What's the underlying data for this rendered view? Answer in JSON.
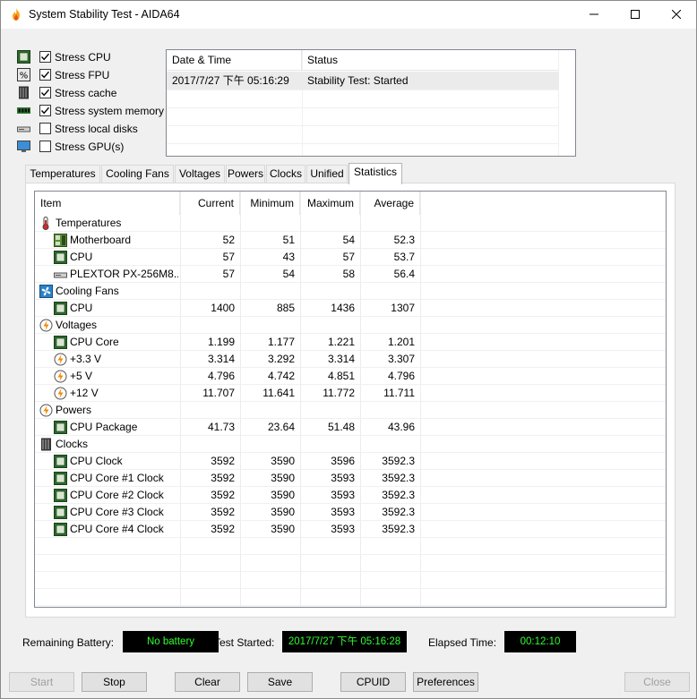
{
  "window": {
    "title": "System Stability Test - AIDA64"
  },
  "stress_options": [
    {
      "label": "Stress CPU",
      "checked": true,
      "icon": "cpu-chip-icon"
    },
    {
      "label": "Stress FPU",
      "checked": true,
      "icon": "fpu-icon"
    },
    {
      "label": "Stress cache",
      "checked": true,
      "icon": "cache-icon"
    },
    {
      "label": "Stress system memory",
      "checked": true,
      "icon": "memory-icon"
    },
    {
      "label": "Stress local disks",
      "checked": false,
      "icon": "disk-icon"
    },
    {
      "label": "Stress GPU(s)",
      "checked": false,
      "icon": "monitor-icon"
    }
  ],
  "log": {
    "headers": {
      "datetime": "Date & Time",
      "status": "Status"
    },
    "rows": [
      {
        "datetime": "2017/7/27 下午 05:16:29",
        "status": "Stability Test: Started"
      }
    ]
  },
  "tabs": [
    "Temperatures",
    "Cooling Fans",
    "Voltages",
    "Powers",
    "Clocks",
    "Unified",
    "Statistics"
  ],
  "active_tab": "Statistics",
  "stats": {
    "headers": {
      "item": "Item",
      "current": "Current",
      "minimum": "Minimum",
      "maximum": "Maximum",
      "average": "Average"
    },
    "rows": [
      {
        "type": "group",
        "label": "Temperatures",
        "icon": "thermometer-icon"
      },
      {
        "type": "item",
        "label": "Motherboard",
        "icon": "motherboard-icon",
        "current": "52",
        "minimum": "51",
        "maximum": "54",
        "average": "52.3"
      },
      {
        "type": "item",
        "label": "CPU",
        "icon": "cpu-chip-icon",
        "current": "57",
        "minimum": "43",
        "maximum": "57",
        "average": "53.7"
      },
      {
        "type": "item",
        "label": "PLEXTOR PX-256M8...",
        "icon": "disk-icon",
        "current": "57",
        "minimum": "54",
        "maximum": "58",
        "average": "56.4"
      },
      {
        "type": "group",
        "label": "Cooling Fans",
        "icon": "fan-icon"
      },
      {
        "type": "item",
        "label": "CPU",
        "icon": "cpu-chip-icon",
        "current": "1400",
        "minimum": "885",
        "maximum": "1436",
        "average": "1307"
      },
      {
        "type": "group",
        "label": "Voltages",
        "icon": "lightning-icon"
      },
      {
        "type": "item",
        "label": "CPU Core",
        "icon": "cpu-chip-icon",
        "current": "1.199",
        "minimum": "1.177",
        "maximum": "1.221",
        "average": "1.201"
      },
      {
        "type": "item",
        "label": "+3.3 V",
        "icon": "lightning-icon",
        "current": "3.314",
        "minimum": "3.292",
        "maximum": "3.314",
        "average": "3.307"
      },
      {
        "type": "item",
        "label": "+5 V",
        "icon": "lightning-icon",
        "current": "4.796",
        "minimum": "4.742",
        "maximum": "4.851",
        "average": "4.796"
      },
      {
        "type": "item",
        "label": "+12 V",
        "icon": "lightning-icon",
        "current": "11.707",
        "minimum": "11.641",
        "maximum": "11.772",
        "average": "11.711"
      },
      {
        "type": "group",
        "label": "Powers",
        "icon": "lightning-icon"
      },
      {
        "type": "item",
        "label": "CPU Package",
        "icon": "cpu-chip-icon",
        "current": "41.73",
        "minimum": "23.64",
        "maximum": "51.48",
        "average": "43.96"
      },
      {
        "type": "group",
        "label": "Clocks",
        "icon": "clock-chip-icon"
      },
      {
        "type": "item",
        "label": "CPU Clock",
        "icon": "cpu-chip-icon",
        "current": "3592",
        "minimum": "3590",
        "maximum": "3596",
        "average": "3592.3"
      },
      {
        "type": "item",
        "label": "CPU Core #1 Clock",
        "icon": "cpu-chip-icon",
        "current": "3592",
        "minimum": "3590",
        "maximum": "3593",
        "average": "3592.3"
      },
      {
        "type": "item",
        "label": "CPU Core #2 Clock",
        "icon": "cpu-chip-icon",
        "current": "3592",
        "minimum": "3590",
        "maximum": "3593",
        "average": "3592.3"
      },
      {
        "type": "item",
        "label": "CPU Core #3 Clock",
        "icon": "cpu-chip-icon",
        "current": "3592",
        "minimum": "3590",
        "maximum": "3593",
        "average": "3592.3"
      },
      {
        "type": "item",
        "label": "CPU Core #4 Clock",
        "icon": "cpu-chip-icon",
        "current": "3592",
        "minimum": "3590",
        "maximum": "3593",
        "average": "3592.3"
      }
    ]
  },
  "status_bar": {
    "battery_label": "Remaining Battery:",
    "battery_value": "No battery",
    "started_label": "Test Started:",
    "started_value": "2017/7/27 下午 05:16:28",
    "elapsed_label": "Elapsed Time:",
    "elapsed_value": "00:12:10"
  },
  "buttons": {
    "start": "Start",
    "stop": "Stop",
    "clear": "Clear",
    "save": "Save",
    "cpuid": "CPUID",
    "preferences": "Preferences",
    "close": "Close"
  },
  "colors": {
    "lcd_text": "#2fff2f",
    "lcd_bg": "#000000",
    "tab_active_bg": "#ffffff"
  }
}
